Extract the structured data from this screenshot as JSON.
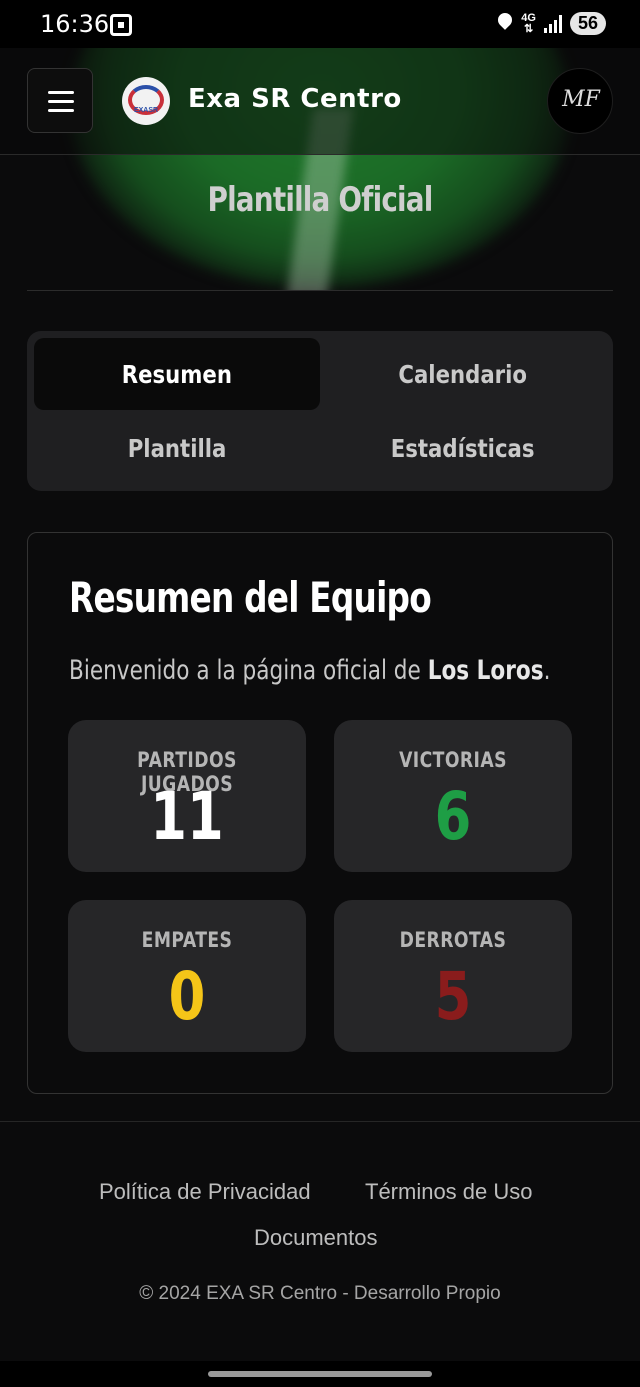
{
  "status_bar": {
    "time": "16:36",
    "network": "4G",
    "battery": "56",
    "icons": [
      "screenshot-icon",
      "location-icon",
      "data-arrows-icon",
      "signal-icon"
    ]
  },
  "header": {
    "brand_title": "Exa SR Centro",
    "logo_text": "EXASR",
    "avatar_initials": "MF",
    "icons": [
      "menu-icon",
      "logo-icon",
      "avatar-icon"
    ]
  },
  "hero": {
    "title": "Plantilla Oficial"
  },
  "tabs": [
    {
      "label": "Resumen",
      "active": true
    },
    {
      "label": "Calendario",
      "active": false
    },
    {
      "label": "Plantilla",
      "active": false
    },
    {
      "label": "Estadísticas",
      "active": false
    }
  ],
  "summary": {
    "title": "Resumen del Equipo",
    "welcome_prefix": "Bienvenido a la página oficial de ",
    "team_name": "Los Loros",
    "welcome_suffix": ".",
    "stats": [
      {
        "label": "PARTIDOS JUGADOS",
        "value": "11",
        "color": "#ffffff"
      },
      {
        "label": "VICTORIAS",
        "value": "6",
        "color": "#1e9e45"
      },
      {
        "label": "EMPATES",
        "value": "0",
        "color": "#f5c518"
      },
      {
        "label": "DERROTAS",
        "value": "5",
        "color": "#8a1c1c"
      }
    ]
  },
  "footer": {
    "links": [
      "Política de Privacidad",
      "Términos de Uso",
      "Documentos"
    ],
    "copyright": "© 2024 EXA SR Centro - Desarrollo Propio"
  }
}
